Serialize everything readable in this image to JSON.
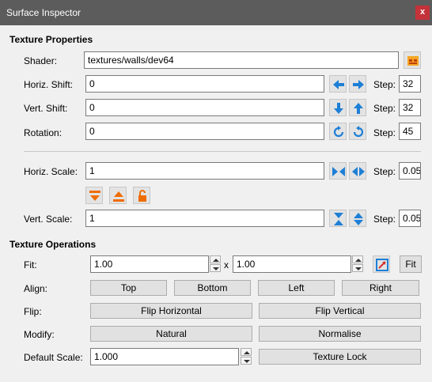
{
  "window": {
    "title": "Surface Inspector",
    "close_label": "x"
  },
  "texture_properties": {
    "heading": "Texture Properties",
    "shader_label": "Shader:",
    "shader_value": "textures/walls/dev64",
    "horiz_shift_label": "Horiz. Shift:",
    "horiz_shift_value": "0",
    "vert_shift_label": "Vert. Shift:",
    "vert_shift_value": "0",
    "rotation_label": "Rotation:",
    "rotation_value": "0",
    "step_label": "Step:",
    "horiz_shift_step": "32",
    "vert_shift_step": "32",
    "rotation_step": "45",
    "horiz_scale_label": "Horiz. Scale:",
    "horiz_scale_value": "1",
    "horiz_scale_step": "0.05",
    "vert_scale_label": "Vert. Scale:",
    "vert_scale_value": "1",
    "vert_scale_step": "0.05"
  },
  "texture_operations": {
    "heading": "Texture Operations",
    "fit_label": "Fit:",
    "fit_width": "1.00",
    "fit_separator": "x",
    "fit_height": "1.00",
    "fit_button": "Fit",
    "align_label": "Align:",
    "align_top": "Top",
    "align_bottom": "Bottom",
    "align_left": "Left",
    "align_right": "Right",
    "flip_label": "Flip:",
    "flip_horizontal": "Flip Horizontal",
    "flip_vertical": "Flip Vertical",
    "modify_label": "Modify:",
    "modify_natural": "Natural",
    "modify_normalise": "Normalise",
    "default_scale_label": "Default Scale:",
    "default_scale_value": "1.000",
    "texture_lock": "Texture Lock"
  },
  "colors": {
    "accent_blue": "#1e7fd6",
    "accent_orange": "#ef6c00",
    "titlebar": "#5c5c5c",
    "close": "#c4323a"
  }
}
